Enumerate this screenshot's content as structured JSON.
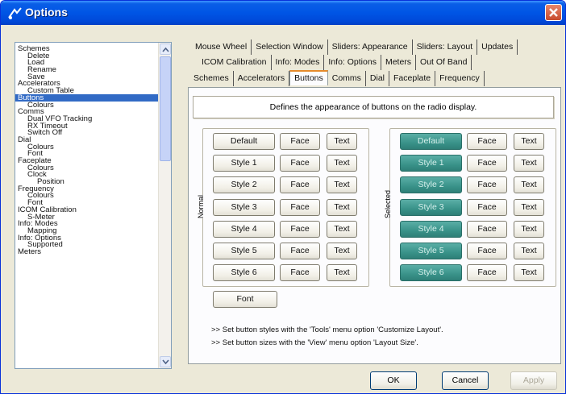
{
  "window": {
    "title": "Options"
  },
  "tree": {
    "items": [
      {
        "label": "Schemes",
        "level": 0
      },
      {
        "label": "Delete",
        "level": 1
      },
      {
        "label": "Load",
        "level": 1
      },
      {
        "label": "Rename",
        "level": 1
      },
      {
        "label": "Save",
        "level": 1
      },
      {
        "label": "Accelerators",
        "level": 0
      },
      {
        "label": "Custom Table",
        "level": 1
      },
      {
        "label": "Buttons",
        "level": 0,
        "selected": true
      },
      {
        "label": "Colours",
        "level": 1
      },
      {
        "label": "Comms",
        "level": 0
      },
      {
        "label": "Dual VFO Tracking",
        "level": 1
      },
      {
        "label": "RX Timeout",
        "level": 1
      },
      {
        "label": "Switch Off",
        "level": 1
      },
      {
        "label": "Dial",
        "level": 0
      },
      {
        "label": "Colours",
        "level": 1
      },
      {
        "label": "Font",
        "level": 1
      },
      {
        "label": "Faceplate",
        "level": 0
      },
      {
        "label": "Colours",
        "level": 1
      },
      {
        "label": "Clock",
        "level": 1
      },
      {
        "label": "Position",
        "level": 2
      },
      {
        "label": "Frequency",
        "level": 0
      },
      {
        "label": "Colours",
        "level": 1
      },
      {
        "label": "Font",
        "level": 1
      },
      {
        "label": "ICOM Calibration",
        "level": 0
      },
      {
        "label": "S-Meter",
        "level": 1
      },
      {
        "label": "Info: Modes",
        "level": 0
      },
      {
        "label": "Mapping",
        "level": 1
      },
      {
        "label": "Info: Options",
        "level": 0
      },
      {
        "label": "Supported",
        "level": 1
      },
      {
        "label": "Meters",
        "level": 0
      }
    ]
  },
  "tabs": {
    "row1": [
      "Mouse Wheel",
      "Selection Window",
      "Sliders: Appearance",
      "Sliders: Layout",
      "Updates"
    ],
    "row2": [
      "ICOM Calibration",
      "Info: Modes",
      "Info: Options",
      "Meters",
      "Out Of Band"
    ],
    "row3": [
      "Schemes",
      "Accelerators",
      "Buttons",
      "Comms",
      "Dial",
      "Faceplate",
      "Frequency"
    ],
    "active": "Buttons"
  },
  "description": "Defines the appearance of buttons on the radio display.",
  "normal": {
    "label": "Normal",
    "styles": [
      "Default",
      "Style 1",
      "Style 2",
      "Style 3",
      "Style 4",
      "Style 5",
      "Style 6"
    ]
  },
  "selected": {
    "label": "Selected",
    "styles": [
      "Default",
      "Style 1",
      "Style 2",
      "Style 3",
      "Style 4",
      "Style 5",
      "Style 6"
    ]
  },
  "face_label": "Face",
  "text_label": "Text",
  "font_button": "Font",
  "notes": [
    ">> Set button styles with the 'Tools' menu option 'Customize Layout'.",
    ">> Set button sizes with the 'View' menu option 'Layout Size'."
  ],
  "dialog_buttons": {
    "ok": "OK",
    "cancel": "Cancel",
    "apply": "Apply"
  },
  "colors": {
    "selected_button": "#399289",
    "title_bar": "#0055e5",
    "tree_selection": "#316ac5"
  }
}
